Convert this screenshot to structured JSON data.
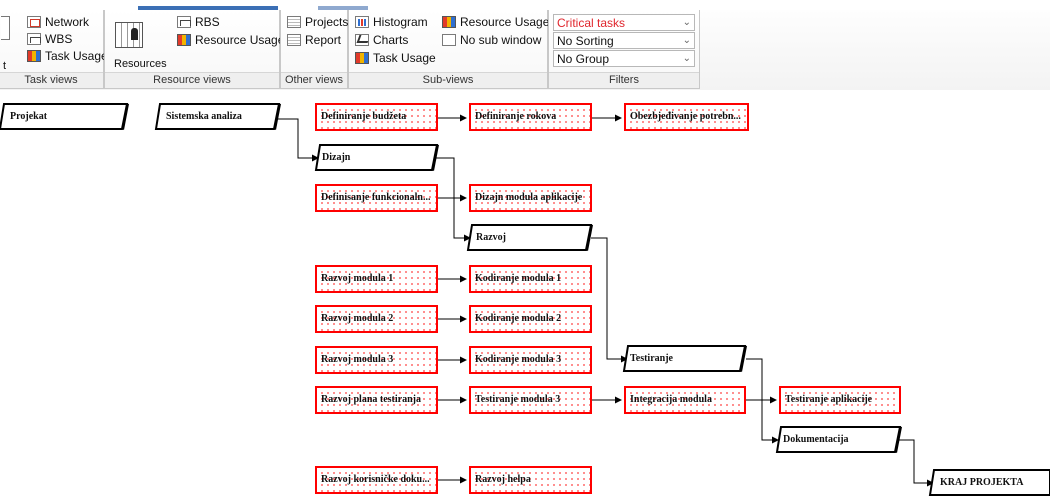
{
  "ribbon": {
    "groups": {
      "task_views": {
        "caption": "Task views",
        "items": [
          {
            "label": "Network",
            "icon": "network-icon"
          },
          {
            "label": "WBS",
            "icon": "wbs-icon"
          },
          {
            "label": "Task Usage",
            "icon": "task-usage-icon"
          }
        ],
        "partial_glyph": "t"
      },
      "resource_views": {
        "caption": "Resource views",
        "resources_label": "Resources",
        "items": [
          {
            "label": "RBS",
            "icon": "rbs-icon"
          },
          {
            "label": "Resource Usage",
            "icon": "resource-usage-icon"
          }
        ]
      },
      "other_views": {
        "caption": "Other views",
        "items": [
          {
            "label": "Projects",
            "icon": "projects-icon"
          },
          {
            "label": "Report",
            "icon": "report-icon"
          }
        ]
      },
      "sub_views": {
        "caption": "Sub-views",
        "items": [
          {
            "label": "Histogram",
            "icon": "histogram-icon"
          },
          {
            "label": "Charts",
            "icon": "charts-icon"
          },
          {
            "label": "Task Usage",
            "icon": "task-usage-icon"
          },
          {
            "label": "Resource Usage",
            "icon": "resource-usage-icon"
          },
          {
            "label": "No sub window",
            "icon": "no-sub-window-icon"
          }
        ]
      },
      "filters": {
        "caption": "Filters",
        "filter_value": "Critical tasks",
        "sorting_value": "No Sorting",
        "group_value": "No Group",
        "critical_color": "#e0262d"
      }
    }
  },
  "diagram": {
    "critical_border_color": "#ff0000",
    "summaries": {
      "projekat": "Projekat",
      "sistemska_analiza": "Sistemska analiza",
      "dizajn": "Dizajn",
      "razvoj": "Razvoj",
      "testiranje": "Testiranje",
      "dokumentacija": "Dokumentacija",
      "kraj_projekta": "KRAJ PROJEKTA"
    },
    "tasks": {
      "definiranje_budzeta": "Definiranje budžeta",
      "definiranje_rokova": "Definiranje rokova",
      "obezbjedivanje_potrebnih": "Obezbjeđivanje potrebn...",
      "definisanje_funkcionalnosti": "Definisanje funkcionaln...",
      "dizajn_modula": "Dizajn modula aplikacije",
      "razvoj_modula_1": "Razvoj modula 1",
      "kodiranje_modula_1": "Kodiranje modula 1",
      "razvoj_modula_2": "Razvoj modula 2",
      "kodiranje_modula_2": "Kodiranje modula 2",
      "razvoj_modula_3": "Razvoj modula 3",
      "kodiranje_modula_3": "Kodiranje modula 3",
      "razvoj_plana_testiranja": "Razvoj plana testiranja",
      "testiranje_modula_3": "Testiranje modula 3",
      "integracija_modula": "Integracija modula",
      "testiranje_aplikacije": "Testiranje aplikacije",
      "razvoj_korisnicke_dok": "Razvoj korisničke doku...",
      "razvoj_helpa": "Razvoj helpa"
    }
  }
}
